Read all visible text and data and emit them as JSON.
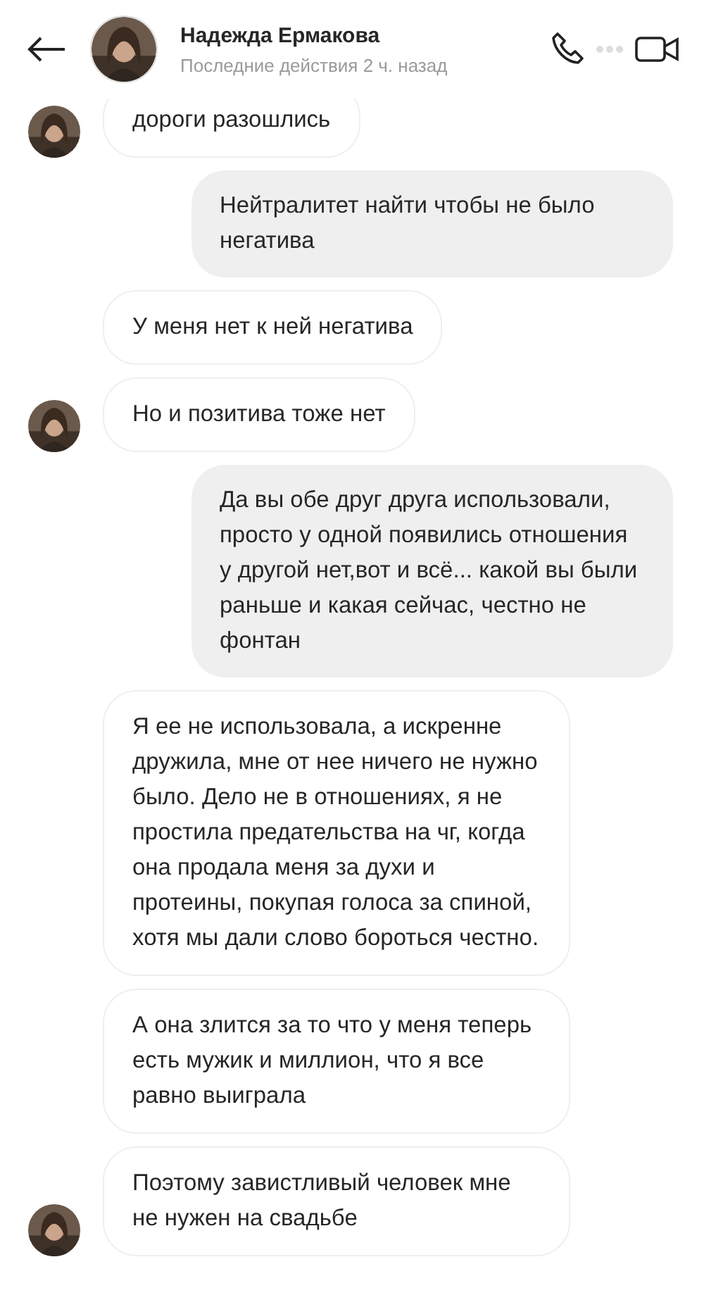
{
  "header": {
    "name": "Надежда Ермакова",
    "status": "Последние действия 2 ч. назад"
  },
  "messages": [
    {
      "kind": "incoming",
      "avatar": true,
      "text": "дороги разошлись"
    },
    {
      "kind": "outgoing",
      "text": "Нейтралитет найти  чтобы не было негатива"
    },
    {
      "kind": "incoming",
      "avatar": false,
      "text": "У меня нет к ней негатива"
    },
    {
      "kind": "incoming",
      "avatar": true,
      "text": "Но и позитива тоже нет"
    },
    {
      "kind": "outgoing",
      "text": "Да вы обе друг друга использовали,  просто у одной появились отношения у другой нет,вот и всё... какой вы были раньше и какая сейчас,  честно не фонтан"
    },
    {
      "kind": "incoming",
      "avatar": false,
      "text": "Я ее не использовала, а искренне дружила, мне от нее ничего не нужно было. Дело не в отношениях, я не простила предательства на чг, когда она продала меня за духи и протеины, покупая голоса за спиной, хотя мы дали слово бороться честно."
    },
    {
      "kind": "incoming",
      "avatar": false,
      "text": "А она злится за то что у меня теперь есть мужик и миллион, что я все равно выиграла"
    },
    {
      "kind": "incoming",
      "avatar": true,
      "text": "Поэтому завистливый человек мне не нужен на свадьбе"
    }
  ]
}
